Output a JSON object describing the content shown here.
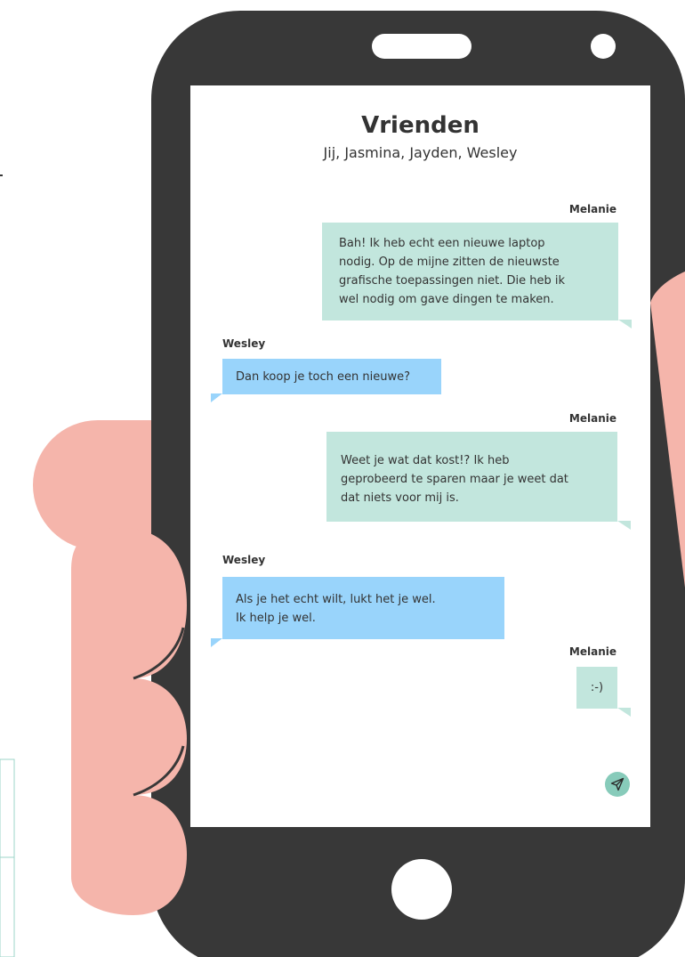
{
  "colors": {
    "phone_body": "#383838",
    "screen_accent": "#c2e6dd",
    "outgoing_bubble": "#c2e6dd",
    "incoming_bubble": "#99d4fb",
    "hand": "#f5b5ab",
    "send_button": "#87cbba"
  },
  "chat": {
    "title": "Vrienden",
    "members": "Jij, Jasmina, Jayden, Wesley"
  },
  "messages": [
    {
      "sender": "Melanie",
      "direction": "outgoing",
      "lines": [
        "Bah! Ik heb echt een nieuwe laptop",
        "nodig. Op de mijne zitten de nieuwste",
        "grafische toepassingen niet. Die heb ik",
        "wel nodig om gave dingen te maken."
      ]
    },
    {
      "sender": "Wesley",
      "direction": "incoming",
      "lines": [
        "Dan koop je toch een nieuwe?"
      ]
    },
    {
      "sender": "Melanie",
      "direction": "outgoing",
      "lines": [
        "Weet je wat dat kost!? Ik heb",
        "geprobeerd te sparen maar je weet dat",
        "dat niets voor mij is."
      ]
    },
    {
      "sender": "Wesley",
      "direction": "incoming",
      "lines": [
        "Als je het echt wilt, lukt het je wel.",
        "Ik help je wel."
      ]
    },
    {
      "sender": "Melanie",
      "direction": "outgoing",
      "lines": [
        ":-)"
      ]
    }
  ],
  "composer": {
    "value": "",
    "send_icon": "paper-plane-icon"
  }
}
